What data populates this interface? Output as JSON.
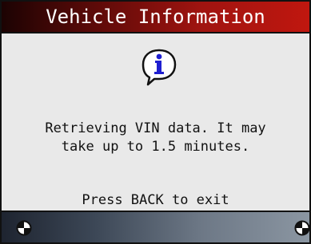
{
  "header": {
    "title": "Vehicle Information"
  },
  "body": {
    "icon": "info-speech-bubble-icon",
    "message_lines": [
      "Retrieving VIN data. It may",
      "take up to 1.5 minutes."
    ],
    "hint": "Press BACK to exit"
  },
  "footer": {
    "left_button_icon": "circle-quadrant-icon",
    "right_button_icon": "circle-quadrant-icon"
  },
  "colors": {
    "title_bar": "#a01410",
    "body_background": "#e9e9e9",
    "footer_bar": "#6d7886",
    "info_icon": "#1f1fd0"
  }
}
